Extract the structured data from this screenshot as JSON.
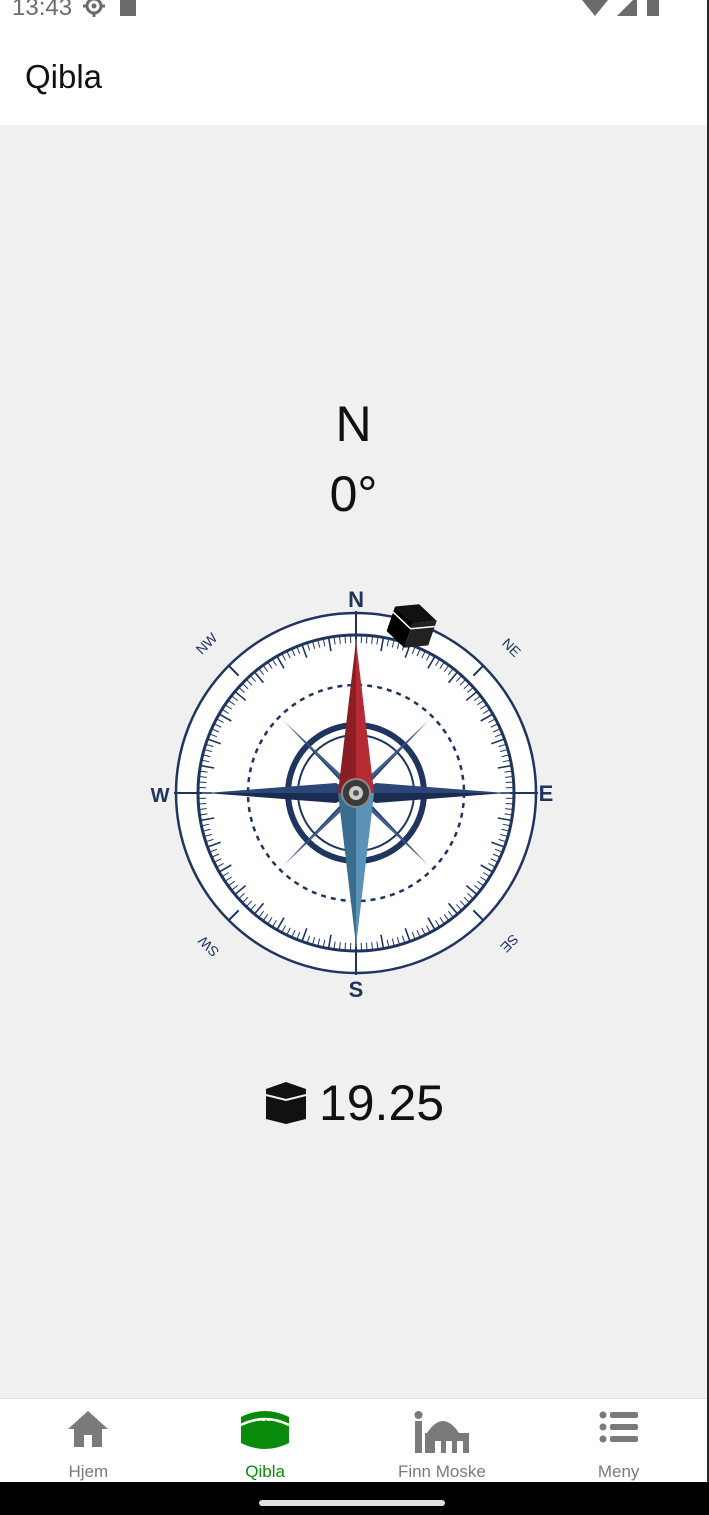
{
  "status_bar": {
    "time": "13:43"
  },
  "app_bar": {
    "title": "Qibla"
  },
  "compass": {
    "direction": "N",
    "degrees": "0°",
    "labels": {
      "n": "N",
      "s": "S",
      "e": "E",
      "w": "W",
      "ne": "NE",
      "nw": "NW",
      "se": "SE",
      "sw": "SW"
    }
  },
  "qibla": {
    "value": "19.25",
    "icon": "kaaba-icon"
  },
  "bottom_nav": {
    "items": [
      {
        "label": "Hjem",
        "icon": "home-icon",
        "active": false
      },
      {
        "label": "Qibla",
        "icon": "kaaba-icon",
        "active": true
      },
      {
        "label": "Finn Moske",
        "icon": "mosque-icon",
        "active": false
      },
      {
        "label": "Meny",
        "icon": "menu-icon",
        "active": false
      }
    ]
  },
  "colors": {
    "accent": "#0a8a0a",
    "compass_navy": "#1f3560",
    "needle_red": "#8b1d24",
    "needle_blue": "#4a7ea0"
  }
}
